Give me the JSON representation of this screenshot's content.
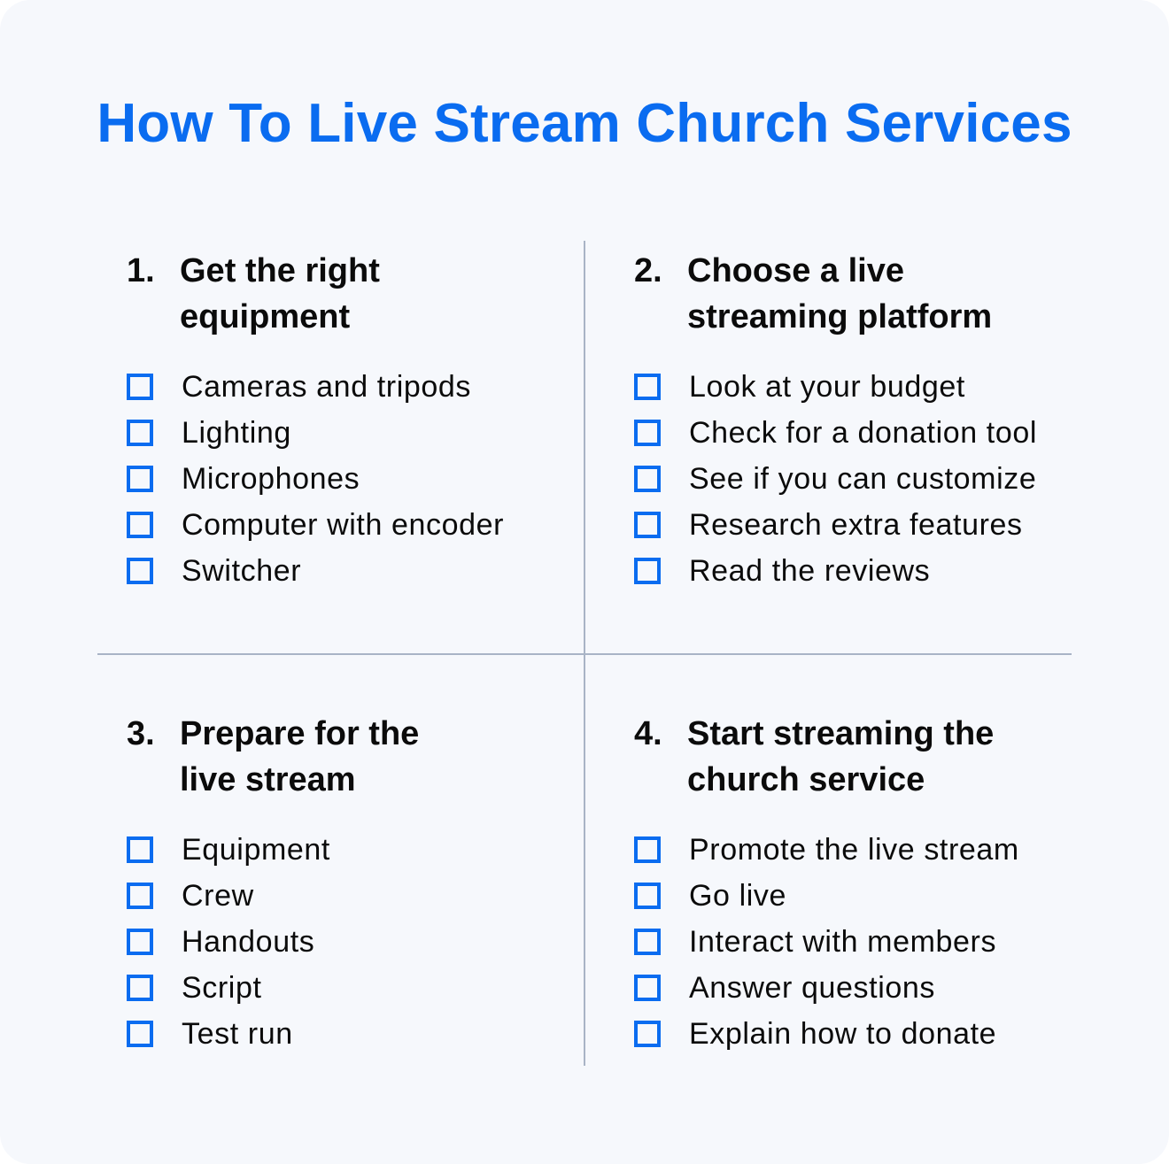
{
  "title": "How To Live Stream Church Services",
  "colors": {
    "accent": "#0a6cf0",
    "background": "#f6f8fc",
    "divider": "#a9b4c6",
    "text": "#0b0b0b"
  },
  "sections": [
    {
      "number": "1.",
      "heading": "Get the right equipment",
      "items": [
        "Cameras and tripods",
        "Lighting",
        "Microphones",
        "Computer with encoder",
        "Switcher"
      ]
    },
    {
      "number": "2.",
      "heading": "Choose a live streaming platform",
      "items": [
        "Look at your budget",
        "Check for a donation tool",
        "See if you can customize",
        "Research extra features",
        "Read the reviews"
      ]
    },
    {
      "number": "3.",
      "heading": "Prepare for the live stream",
      "items": [
        "Equipment",
        "Crew",
        "Handouts",
        "Script",
        "Test run"
      ]
    },
    {
      "number": "4.",
      "heading": "Start streaming the church service",
      "items": [
        "Promote the live stream",
        "Go live",
        "Interact with members",
        "Answer questions",
        "Explain how to donate"
      ]
    }
  ]
}
